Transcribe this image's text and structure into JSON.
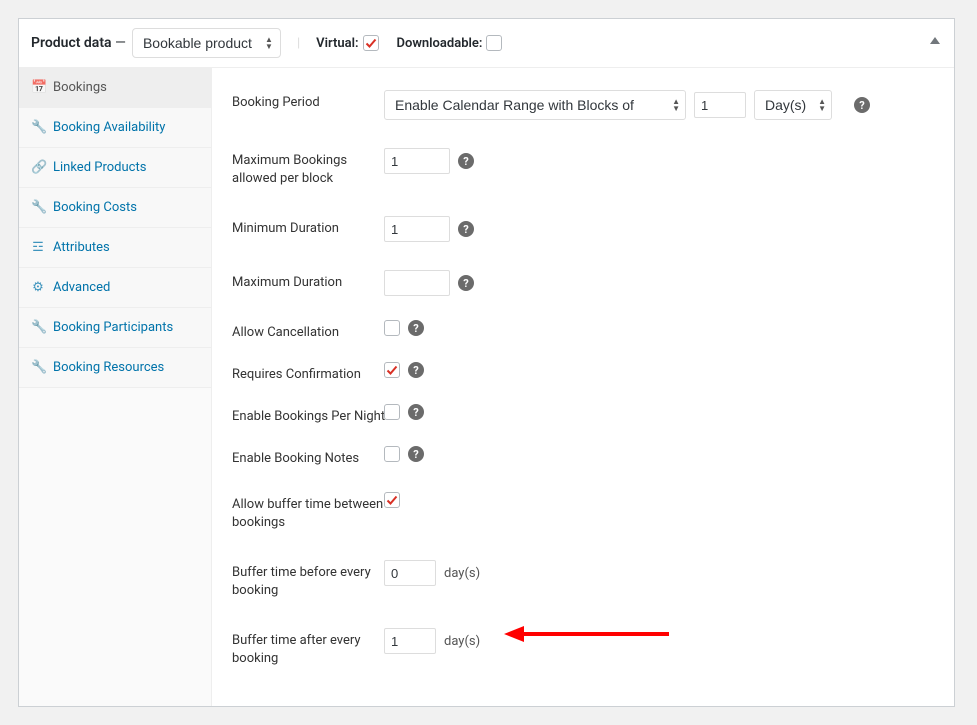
{
  "header": {
    "title_prefix": "Product data",
    "title_dash": " — ",
    "product_type": "Bookable product",
    "virtual_label": "Virtual:",
    "virtual_checked": true,
    "downloadable_label": "Downloadable:",
    "downloadable_checked": false
  },
  "tabs": [
    {
      "label": "Bookings",
      "icon": "calendar",
      "active": true
    },
    {
      "label": "Booking Availability",
      "icon": "wrench",
      "active": false
    },
    {
      "label": "Linked Products",
      "icon": "link",
      "active": false
    },
    {
      "label": "Booking Costs",
      "icon": "wrench",
      "active": false
    },
    {
      "label": "Attributes",
      "icon": "list",
      "active": false
    },
    {
      "label": "Advanced",
      "icon": "gear",
      "active": false
    },
    {
      "label": "Booking Participants",
      "icon": "wrench",
      "active": false
    },
    {
      "label": "Booking Resources",
      "icon": "wrench",
      "active": false
    }
  ],
  "fields": {
    "booking_period": {
      "label": "Booking Period",
      "mode": "Enable Calendar Range with Blocks of",
      "qty": "1",
      "unit": "Day(s)"
    },
    "max_bookings": {
      "label": "Maximum Bookings allowed per block",
      "value": "1"
    },
    "min_duration": {
      "label": "Minimum Duration",
      "value": "1"
    },
    "max_duration": {
      "label": "Maximum Duration",
      "value": ""
    },
    "allow_cancellation": {
      "label": "Allow Cancellation",
      "checked": false
    },
    "requires_confirmation": {
      "label": "Requires Confirmation",
      "checked": true
    },
    "per_night": {
      "label": "Enable Bookings Per Night",
      "checked": false
    },
    "booking_notes": {
      "label": "Enable Booking Notes",
      "checked": false
    },
    "allow_buffer": {
      "label": "Allow buffer time between bookings",
      "checked": true
    },
    "buffer_before": {
      "label": "Buffer time before every booking",
      "value": "0",
      "unit": "day(s)"
    },
    "buffer_after": {
      "label": "Buffer time after every booking",
      "value": "1",
      "unit": "day(s)"
    }
  },
  "icons": {
    "calendar": "📅",
    "wrench": "🔧",
    "link": "🔗",
    "list": "☲",
    "gear": "⚙"
  }
}
